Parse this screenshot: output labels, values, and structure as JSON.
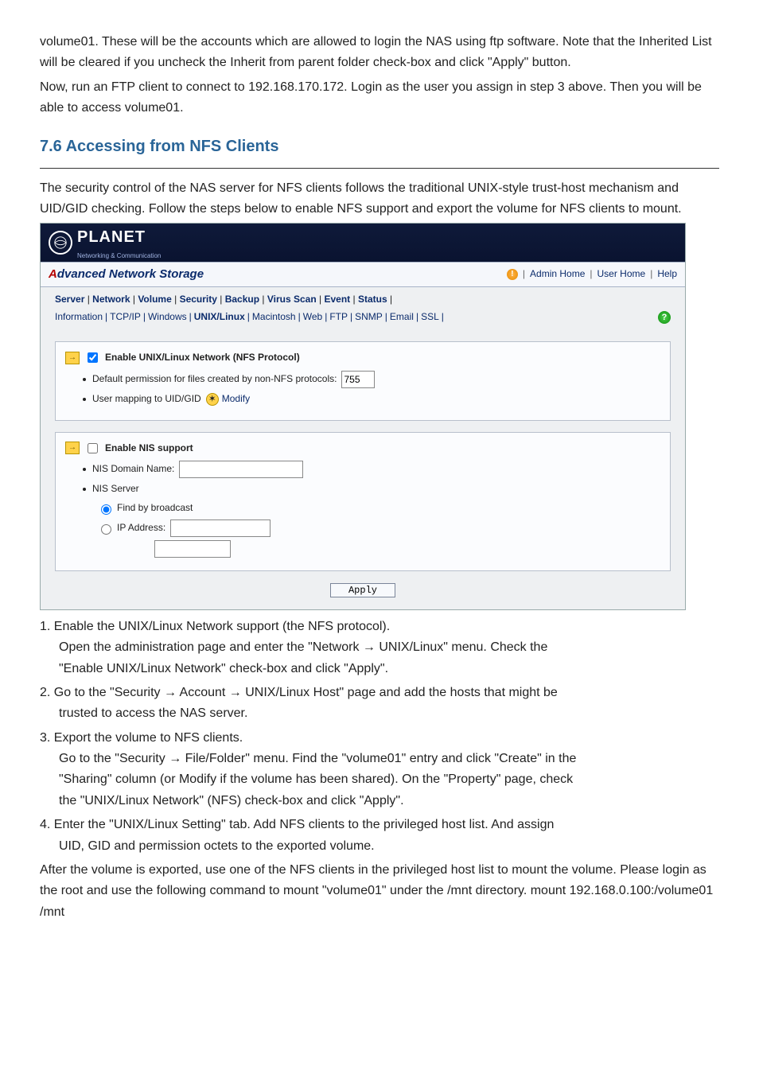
{
  "intro": {
    "p1": "volume01. These will be the accounts which are allowed to login the NAS using ftp software. Note that the Inherited List will be cleared if you uncheck the Inherit from parent folder check-box and click \"Apply\" button.",
    "p2": "Now, run an FTP client to connect to 192.168.170.172. Login as the user you assign in step 3 above. Then you will be able to access volume01."
  },
  "section_title": "7.6 Accessing from NFS Clients",
  "section_intro": "The security control of the NAS server for NFS clients follows the traditional UNIX-style trust-host mechanism and UID/GID checking. Follow the steps below to enable NFS support and export the volume for NFS clients to mount.",
  "app": {
    "brand": "PLANET",
    "brand_sub": "Networking & Communication",
    "title_prefix": "A",
    "title_rest": "dvanced Network Storage",
    "top_links": {
      "admin": "Admin Home",
      "user": "User Home",
      "help": "Help"
    },
    "tabs1": [
      "Server",
      "Network",
      "Volume",
      "Security",
      "Backup",
      "Virus Scan",
      "Event",
      "Status"
    ],
    "tabs1_selected": "Network",
    "tabs2": [
      "Information",
      "TCP/IP",
      "Windows",
      "UNIX/Linux",
      "Macintosh",
      "Web",
      "FTP",
      "SNMP",
      "Email",
      "SSL"
    ],
    "tabs2_selected": "UNIX/Linux",
    "panel_nfs": {
      "title": "Enable UNIX/Linux Network (NFS Protocol)",
      "checked": true,
      "perm_label": "Default permission for files created by non-NFS protocols:",
      "perm_value": "755",
      "map_label": "User mapping to UID/GID",
      "modify": "Modify"
    },
    "panel_nis": {
      "title": "Enable NIS support",
      "checked": false,
      "domain_label": "NIS Domain Name:",
      "domain_value": "",
      "server_label": "NIS Server",
      "find_label": "Find by broadcast",
      "ip_label": "IP Address:",
      "ip_value": "",
      "radio_find": true
    },
    "apply": "Apply"
  },
  "steps": {
    "s1_head": "1. Enable the UNIX/Linux Network support (the NFS protocol).",
    "s1_a": "Open the administration page and enter the \"Network → UNIX/Linux\" menu. Check the",
    "s1_b": "\"Enable UNIX/Linux Network\" check-box and click \"Apply\".",
    "s2_head": "2. Go to the \"Security → Account → UNIX/Linux Host\" page and add the hosts that might be",
    "s2_a": "trusted to access the NAS server.",
    "s3_head": "3. Export the volume to NFS clients.",
    "s3_a": "Go to the \"Security → File/Folder\" menu. Find the \"volume01\" entry and click \"Create\" in the",
    "s3_b": "\"Sharing\" column (or Modify if the volume has been shared). On the \"Property\" page, check",
    "s3_c": "the \"UNIX/Linux Network\" (NFS) check-box and click \"Apply\".",
    "s4_head": "4. Enter the \"UNIX/Linux Setting\" tab. Add NFS clients to the privileged host list. And assign",
    "s4_a": "UID, GID and permission octets to the exported volume."
  },
  "closing": {
    "p1": "After the volume is exported, use one of the NFS clients in the privileged host list to mount the volume. Please login as the root and use the following command to mount \"volume01\" under the /mnt directory. mount 192.168.0.100:/volume01 /mnt"
  }
}
